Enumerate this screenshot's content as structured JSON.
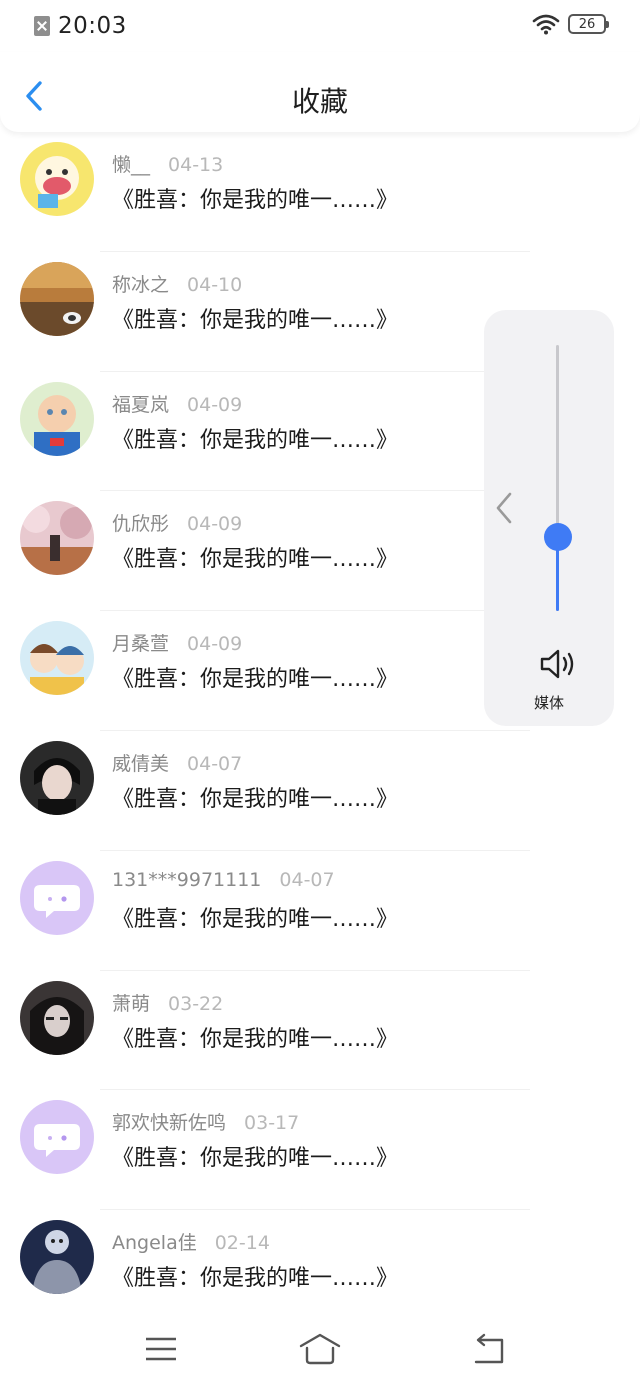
{
  "status_bar": {
    "time": "20:03",
    "battery_level": "26"
  },
  "header": {
    "title": "收藏",
    "back_icon": "chevron-left-icon"
  },
  "colors": {
    "accent": "#3f7bf5",
    "back_arrow": "#2b8ef0",
    "name_text": "#8a8a8a",
    "date_text": "#b8b8b8"
  },
  "favorites": [
    {
      "name": "懒__",
      "date": "04-13",
      "title": "《胜喜：你是我的唯一……》"
    },
    {
      "name": "称冰之",
      "date": "04-10",
      "title": "《胜喜：你是我的唯一……》"
    },
    {
      "name": "福夏岚",
      "date": "04-09",
      "title": "《胜喜：你是我的唯一……》"
    },
    {
      "name": "仇欣彤",
      "date": "04-09",
      "title": "《胜喜：你是我的唯一……》"
    },
    {
      "name": "月桑萱",
      "date": "04-09",
      "title": "《胜喜：你是我的唯一……》"
    },
    {
      "name": "威倩美",
      "date": "04-07",
      "title": "《胜喜：你是我的唯一……》"
    },
    {
      "name": "131***9971111",
      "date": "04-07",
      "title": "《胜喜：你是我的唯一……》"
    },
    {
      "name": "萧萌",
      "date": "03-22",
      "title": "《胜喜：你是我的唯一……》"
    },
    {
      "name": "郭欢快新佐鸣",
      "date": "03-17",
      "title": "《胜喜：你是我的唯一……》"
    },
    {
      "name": "Angela佳",
      "date": "02-14",
      "title": "《胜喜：你是我的唯一……》"
    }
  ],
  "volume": {
    "label": "媒体",
    "level_percent": 28,
    "icon": "speaker-icon"
  },
  "navigation": {
    "menu_icon": "menu-icon",
    "home_icon": "home-icon",
    "back_icon": "back-icon"
  }
}
